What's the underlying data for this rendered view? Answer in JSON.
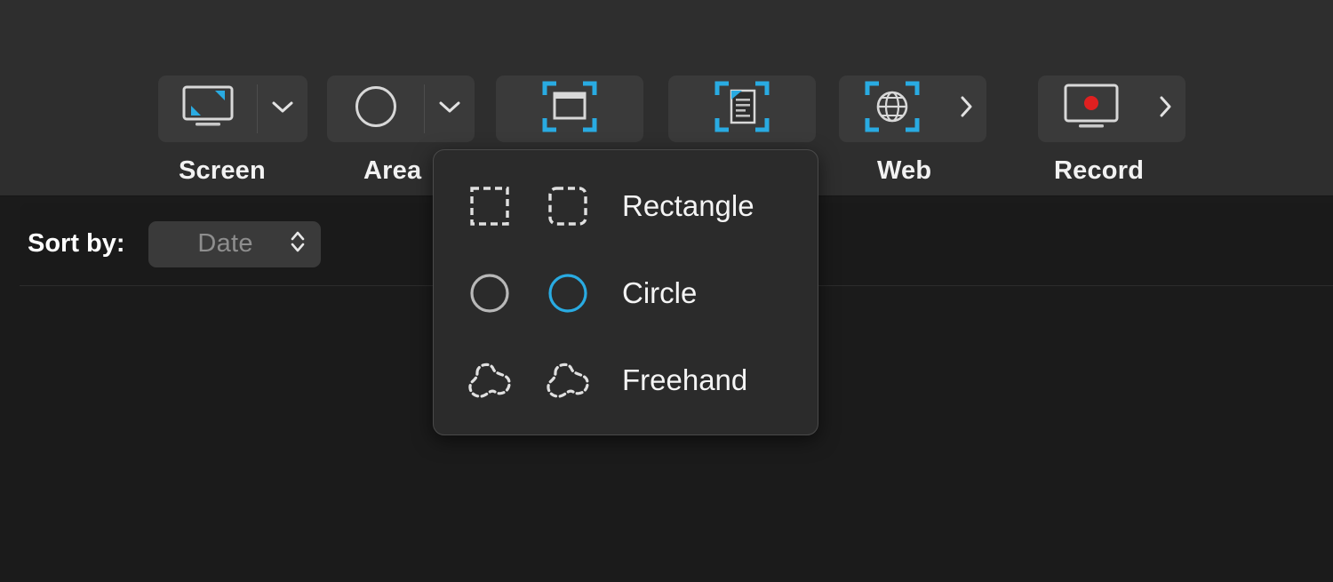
{
  "toolbar": {
    "items": [
      {
        "id": "screen",
        "label": "Screen",
        "icon": "monitor-capture-icon",
        "trailing": "chevron-down-icon"
      },
      {
        "id": "area",
        "label": "Area",
        "icon": "circle-selection-icon",
        "trailing": "chevron-down-icon"
      },
      {
        "id": "window",
        "label": "",
        "icon": "window-capture-icon",
        "trailing": "none"
      },
      {
        "id": "document",
        "label": "",
        "icon": "document-capture-icon",
        "trailing": "none"
      },
      {
        "id": "web",
        "label": "Web",
        "icon": "globe-capture-icon",
        "trailing": "chevron-right-icon"
      },
      {
        "id": "record",
        "label": "Record",
        "icon": "screen-record-icon",
        "trailing": "chevron-right-icon"
      }
    ]
  },
  "sort": {
    "label": "Sort by:",
    "value": "Date",
    "stepper_icon": "up-down-chevron-icon",
    "options": [
      "Date"
    ]
  },
  "popover": {
    "items": [
      {
        "label": "Rectangle",
        "icon_left": "dashed-rectangle-icon",
        "icon_right": "dashed-rounded-rectangle-icon",
        "selected": false
      },
      {
        "label": "Circle",
        "icon_left": "circle-outline-icon",
        "icon_right": "circle-outline-icon",
        "selected": true
      },
      {
        "label": "Freehand",
        "icon_left": "dashed-blob-icon",
        "icon_right": "dashed-blob-icon",
        "selected": false
      }
    ]
  },
  "colors": {
    "accent_blue": "#29ABE2",
    "record_red": "#E02020",
    "toolbar_bg": "#2e2e2e",
    "panel_bg": "#1b1b1b",
    "popover_bg": "#2b2b2b",
    "text_primary": "#f2f2f2",
    "text_dim": "#8e8e8e"
  }
}
